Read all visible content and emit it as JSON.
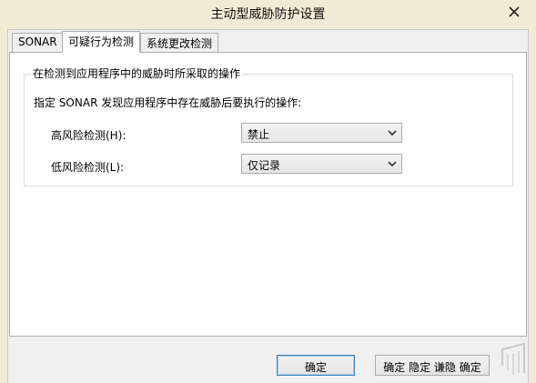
{
  "window": {
    "title": "主动型威胁防护设置",
    "close_icon": "close-icon"
  },
  "tabs": [
    {
      "label": "SONAR",
      "active": false
    },
    {
      "label": "可疑行为检测",
      "active": true
    },
    {
      "label": "系统更改检测",
      "active": false
    }
  ],
  "panel": {
    "group_title": "在检测到应用程序中的威胁时所采取的操作",
    "description": "指定 SONAR 发现应用程序中存在威胁后要执行的操作:",
    "fields": [
      {
        "label": "高风险检测(H):",
        "selected": "禁止"
      },
      {
        "label": "低风险检测(L):",
        "selected": "仅记录"
      }
    ]
  },
  "footer": {
    "ok_label": "确定",
    "cancel_label": "确定 隐定 谦隐 确定"
  },
  "colors": {
    "title_bar": "#f0ebd4",
    "primary_border": "#3c7fb1"
  }
}
